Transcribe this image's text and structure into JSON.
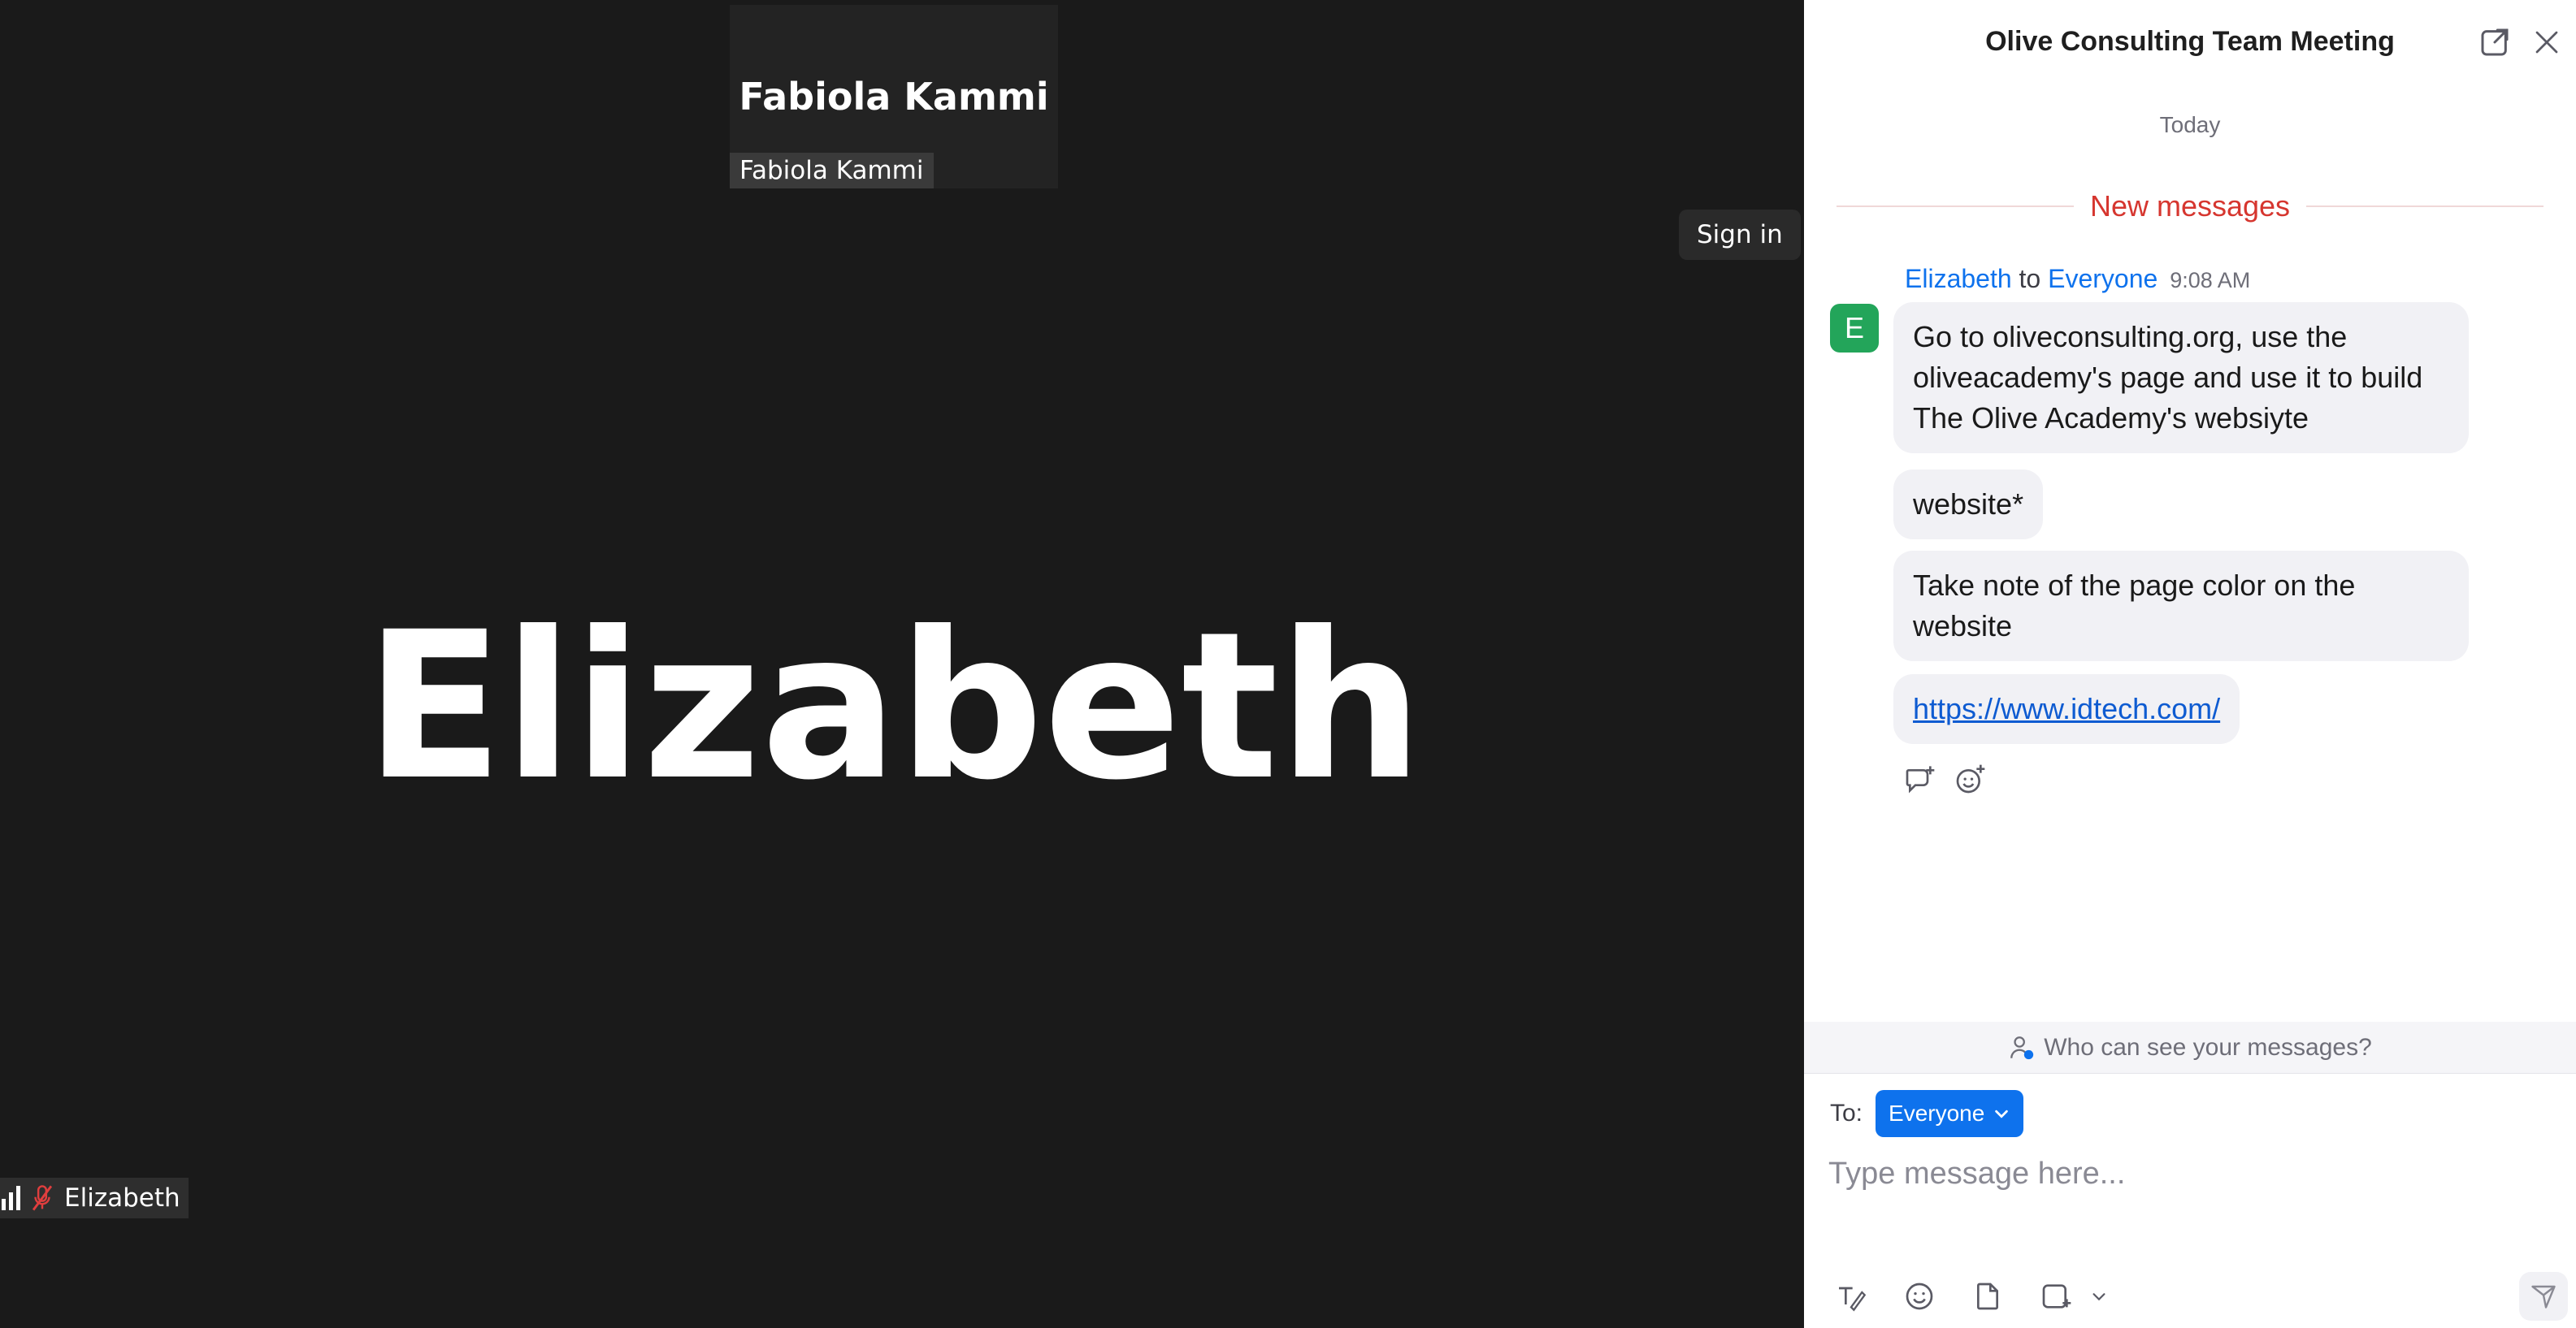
{
  "video": {
    "thumbnail": {
      "display_name": "Fabiola Kammi",
      "name_tag": "Fabiola Kammi"
    },
    "sign_in_label": "Sign in",
    "active_speaker_name": "Elizabeth",
    "participant_tag": {
      "name": "Elizabeth",
      "mic_state": "muted"
    }
  },
  "chat": {
    "title": "Olive Consulting Team Meeting",
    "date_label": "Today",
    "new_messages_label": "New messages",
    "sender_avatar_letter": "E",
    "sender": "Elizabeth",
    "to_word": "to",
    "recipient": "Everyone",
    "time": "9:08 AM",
    "messages": [
      "Go to oliveconsulting.org, use the oliveacademy's page and use it to build The Olive Academy's websiyte",
      "website*",
      "Take note of the page color on the website",
      "https://www.idtech.com/"
    ],
    "visibility_notice": "Who can see your messages?",
    "to_label": "To:",
    "to_value": "Everyone",
    "input_placeholder": "Type message here...",
    "colors": {
      "accent": "#0e72ed",
      "new_messages": "#d6362f",
      "avatar": "#23a55a"
    }
  }
}
